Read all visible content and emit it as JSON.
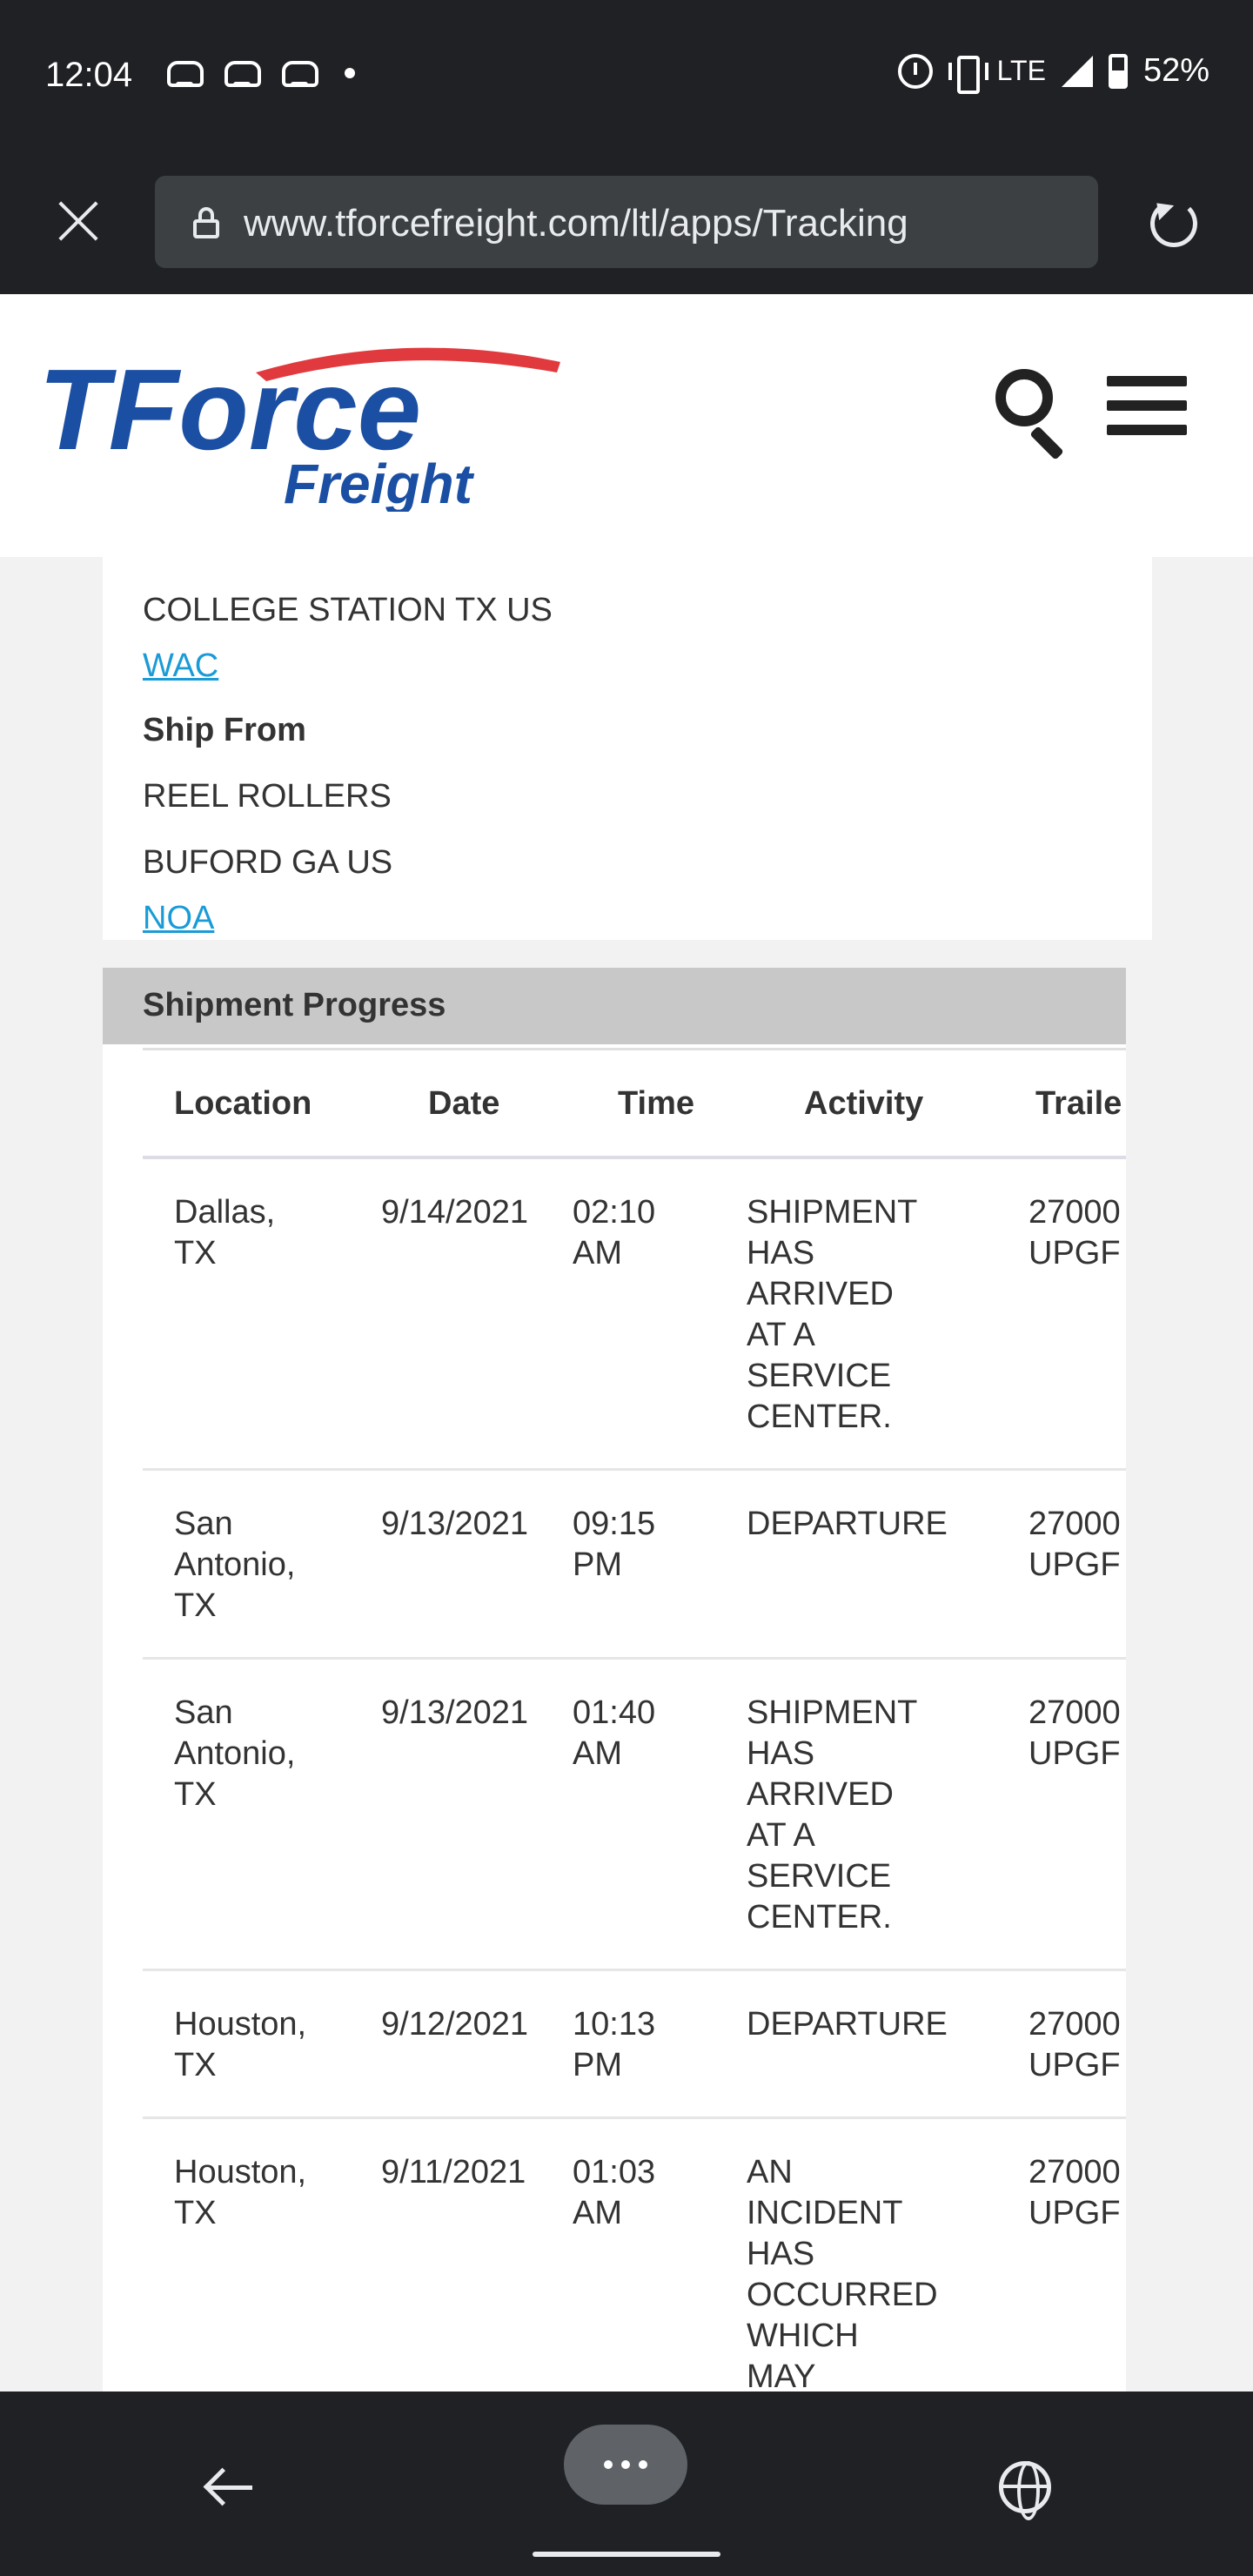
{
  "status_bar": {
    "time": "12:04",
    "network": "LTE",
    "battery": "52%"
  },
  "browser": {
    "url": "www.tforcefreight.com/ltl/apps/Tracking"
  },
  "site": {
    "logo_top": "TForce",
    "logo_bottom": "Freight",
    "colors": {
      "brand_blue": "#1b4fa3",
      "brand_red": "#e03a3e",
      "link": "#1a9bd7"
    }
  },
  "ship_to": {
    "city_line": "COLLEGE STATION TX US",
    "terminal": "WAC"
  },
  "ship_from": {
    "heading": "Ship From",
    "name": "REEL ROLLERS",
    "city_line": "BUFORD GA US",
    "terminal": "NOA"
  },
  "progress": {
    "title": "Shipment Progress",
    "columns": [
      "Location",
      "Date",
      "Time",
      "Activity",
      "Traile"
    ],
    "rows": [
      {
        "location": [
          "Dallas,",
          "TX"
        ],
        "date": "9/14/2021",
        "time": [
          "02:10",
          "AM"
        ],
        "activity": [
          "SHIPMENT",
          "HAS",
          "ARRIVED",
          "AT A",
          "SERVICE",
          "CENTER."
        ],
        "trailer": [
          "27000",
          "UPGF"
        ]
      },
      {
        "location": [
          "San",
          "Antonio,",
          "TX"
        ],
        "date": "9/13/2021",
        "time": [
          "09:15",
          "PM"
        ],
        "activity": [
          "DEPARTURE"
        ],
        "trailer": [
          "27000",
          "UPGF"
        ]
      },
      {
        "location": [
          "San",
          "Antonio,",
          "TX"
        ],
        "date": "9/13/2021",
        "time": [
          "01:40",
          "AM"
        ],
        "activity": [
          "SHIPMENT",
          "HAS",
          "ARRIVED",
          "AT A",
          "SERVICE",
          "CENTER."
        ],
        "trailer": [
          "27000",
          "UPGF"
        ]
      },
      {
        "location": [
          "Houston,",
          "TX"
        ],
        "date": "9/12/2021",
        "time": [
          "10:13",
          "PM"
        ],
        "activity": [
          "DEPARTURE"
        ],
        "trailer": [
          "27000",
          "UPGF"
        ]
      },
      {
        "location": [
          "Houston,",
          "TX"
        ],
        "date": "9/11/2021",
        "time": [
          "01:03",
          "AM"
        ],
        "activity": [
          "AN",
          "INCIDENT",
          "HAS",
          "OCCURRED",
          "WHICH",
          "MAY"
        ],
        "trailer": [
          "27000",
          "UPGF"
        ]
      }
    ]
  }
}
